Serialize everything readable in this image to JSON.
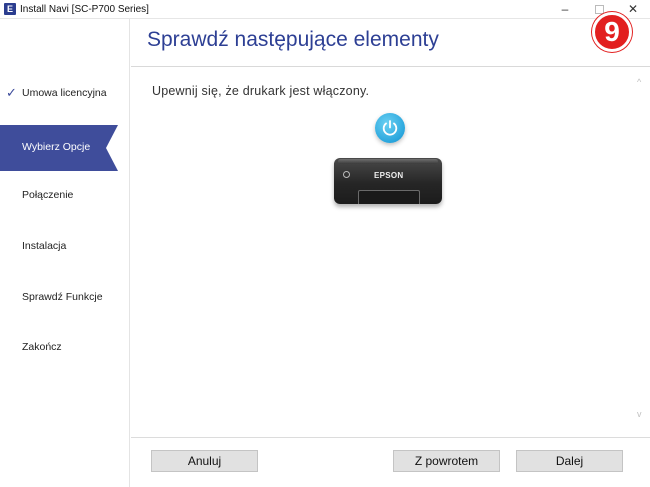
{
  "window": {
    "app_icon": "E",
    "title": "Install Navi [SC-P700 Series]",
    "minimize": "–",
    "close": "✕"
  },
  "badge": "9",
  "sidebar": {
    "items": [
      {
        "label": "Umowa licencyjna",
        "state": "done",
        "check": "✓"
      },
      {
        "label": "Wybierz Opcje",
        "state": "active"
      },
      {
        "label": "Połączenie",
        "state": "pending"
      },
      {
        "label": "Instalacja",
        "state": "pending"
      },
      {
        "label": "Sprawdź Funkcje",
        "state": "pending"
      },
      {
        "label": "Zakończ",
        "state": "pending"
      }
    ]
  },
  "header": {
    "title": "Sprawdź następujące elementy"
  },
  "main": {
    "instruction": "Upewnij się, że drukark jest włączony.",
    "printer_brand": "EPSON",
    "scroll_up": "^",
    "scroll_down": "v"
  },
  "footer": {
    "cancel_label": "Anuluj",
    "back_label": "Z powrotem",
    "next_label": "Dalej"
  },
  "colors": {
    "accent": "#3f4d9b",
    "title": "#2d3f94",
    "power": "#2aa6dd",
    "badge": "#e21f1f"
  }
}
